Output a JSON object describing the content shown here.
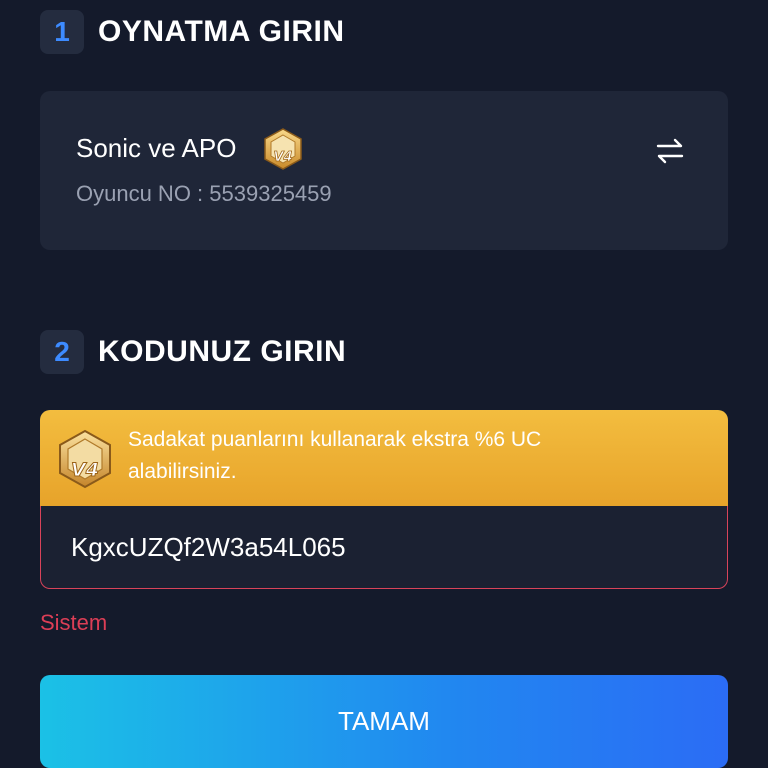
{
  "step1": {
    "number": "1",
    "title": "OYNATMA GIRIN"
  },
  "player": {
    "name": "Sonic ve APO",
    "badge_level": "V4",
    "id_label": "Oyuncu NO : ",
    "id_value": "5539325459",
    "swap_icon": "swap-arrows-icon"
  },
  "step2": {
    "number": "2",
    "title": "KODUNUZ GIRIN"
  },
  "loyalty": {
    "badge_level": "V4",
    "text": "Sadakat puanlarını kullanarak ekstra %6 UC alabilirsiniz."
  },
  "code_input": {
    "value": "KgxcUZQf2W3a54L065",
    "placeholder": ""
  },
  "error_text": "Sistem",
  "submit_label": "TAMAM",
  "colors": {
    "background": "#141a2b",
    "card": "#1f2638",
    "accent_blue": "#3d8bff",
    "error_red": "#dc3e56",
    "gold": "#f3bd3f"
  }
}
